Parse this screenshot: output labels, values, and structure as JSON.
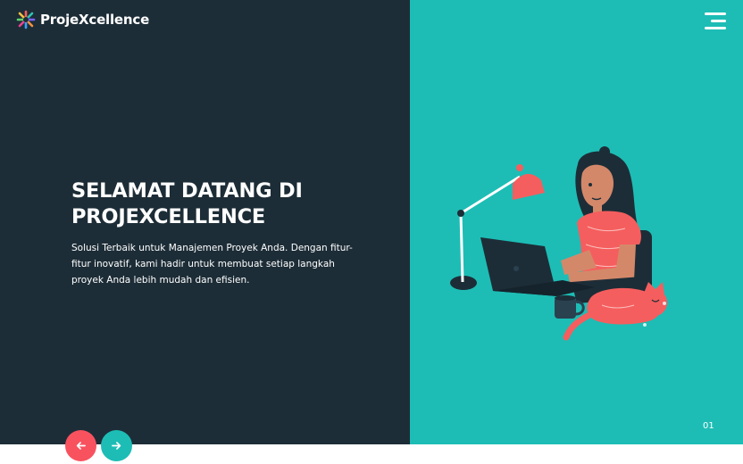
{
  "colors": {
    "left_panel_bg": "#1d2d37",
    "accent": "#1dbdb5",
    "prev_button": "#f8525f",
    "illustration_coral": "#f55e5e"
  },
  "brand": {
    "name": "ProjeXcellence",
    "logo_icon": "colorful-burst-logo-icon"
  },
  "header": {
    "menu_icon": "hamburger-menu-icon"
  },
  "hero": {
    "title_lines": [
      "SELAMAT DATANG DI",
      "PROJEXCELLENCE"
    ],
    "description_lines": [
      "Solusi Terbaik untuk Manajemen Proyek Anda. Dengan fitur-",
      "fitur inovatif, kami hadir untuk membuat setiap langkah",
      "proyek Anda lebih mudah dan efisien."
    ],
    "illustration": "woman-working-on-laptop-with-cat-illustration"
  },
  "slider": {
    "prev_icon": "arrow-left-icon",
    "next_icon": "arrow-right-icon",
    "counter": "01"
  }
}
